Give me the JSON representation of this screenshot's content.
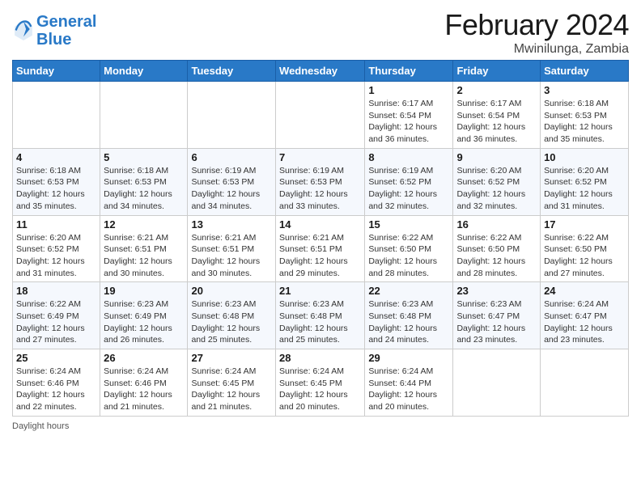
{
  "header": {
    "logo_line1": "General",
    "logo_line2": "Blue",
    "title": "February 2024",
    "subtitle": "Mwinilunga, Zambia"
  },
  "days_of_week": [
    "Sunday",
    "Monday",
    "Tuesday",
    "Wednesday",
    "Thursday",
    "Friday",
    "Saturday"
  ],
  "weeks": [
    [
      {
        "day": "",
        "info": ""
      },
      {
        "day": "",
        "info": ""
      },
      {
        "day": "",
        "info": ""
      },
      {
        "day": "",
        "info": ""
      },
      {
        "day": "1",
        "info": "Sunrise: 6:17 AM\nSunset: 6:54 PM\nDaylight: 12 hours and 36 minutes."
      },
      {
        "day": "2",
        "info": "Sunrise: 6:17 AM\nSunset: 6:54 PM\nDaylight: 12 hours and 36 minutes."
      },
      {
        "day": "3",
        "info": "Sunrise: 6:18 AM\nSunset: 6:53 PM\nDaylight: 12 hours and 35 minutes."
      }
    ],
    [
      {
        "day": "4",
        "info": "Sunrise: 6:18 AM\nSunset: 6:53 PM\nDaylight: 12 hours and 35 minutes."
      },
      {
        "day": "5",
        "info": "Sunrise: 6:18 AM\nSunset: 6:53 PM\nDaylight: 12 hours and 34 minutes."
      },
      {
        "day": "6",
        "info": "Sunrise: 6:19 AM\nSunset: 6:53 PM\nDaylight: 12 hours and 34 minutes."
      },
      {
        "day": "7",
        "info": "Sunrise: 6:19 AM\nSunset: 6:53 PM\nDaylight: 12 hours and 33 minutes."
      },
      {
        "day": "8",
        "info": "Sunrise: 6:19 AM\nSunset: 6:52 PM\nDaylight: 12 hours and 32 minutes."
      },
      {
        "day": "9",
        "info": "Sunrise: 6:20 AM\nSunset: 6:52 PM\nDaylight: 12 hours and 32 minutes."
      },
      {
        "day": "10",
        "info": "Sunrise: 6:20 AM\nSunset: 6:52 PM\nDaylight: 12 hours and 31 minutes."
      }
    ],
    [
      {
        "day": "11",
        "info": "Sunrise: 6:20 AM\nSunset: 6:52 PM\nDaylight: 12 hours and 31 minutes."
      },
      {
        "day": "12",
        "info": "Sunrise: 6:21 AM\nSunset: 6:51 PM\nDaylight: 12 hours and 30 minutes."
      },
      {
        "day": "13",
        "info": "Sunrise: 6:21 AM\nSunset: 6:51 PM\nDaylight: 12 hours and 30 minutes."
      },
      {
        "day": "14",
        "info": "Sunrise: 6:21 AM\nSunset: 6:51 PM\nDaylight: 12 hours and 29 minutes."
      },
      {
        "day": "15",
        "info": "Sunrise: 6:22 AM\nSunset: 6:50 PM\nDaylight: 12 hours and 28 minutes."
      },
      {
        "day": "16",
        "info": "Sunrise: 6:22 AM\nSunset: 6:50 PM\nDaylight: 12 hours and 28 minutes."
      },
      {
        "day": "17",
        "info": "Sunrise: 6:22 AM\nSunset: 6:50 PM\nDaylight: 12 hours and 27 minutes."
      }
    ],
    [
      {
        "day": "18",
        "info": "Sunrise: 6:22 AM\nSunset: 6:49 PM\nDaylight: 12 hours and 27 minutes."
      },
      {
        "day": "19",
        "info": "Sunrise: 6:23 AM\nSunset: 6:49 PM\nDaylight: 12 hours and 26 minutes."
      },
      {
        "day": "20",
        "info": "Sunrise: 6:23 AM\nSunset: 6:48 PM\nDaylight: 12 hours and 25 minutes."
      },
      {
        "day": "21",
        "info": "Sunrise: 6:23 AM\nSunset: 6:48 PM\nDaylight: 12 hours and 25 minutes."
      },
      {
        "day": "22",
        "info": "Sunrise: 6:23 AM\nSunset: 6:48 PM\nDaylight: 12 hours and 24 minutes."
      },
      {
        "day": "23",
        "info": "Sunrise: 6:23 AM\nSunset: 6:47 PM\nDaylight: 12 hours and 23 minutes."
      },
      {
        "day": "24",
        "info": "Sunrise: 6:24 AM\nSunset: 6:47 PM\nDaylight: 12 hours and 23 minutes."
      }
    ],
    [
      {
        "day": "25",
        "info": "Sunrise: 6:24 AM\nSunset: 6:46 PM\nDaylight: 12 hours and 22 minutes."
      },
      {
        "day": "26",
        "info": "Sunrise: 6:24 AM\nSunset: 6:46 PM\nDaylight: 12 hours and 21 minutes."
      },
      {
        "day": "27",
        "info": "Sunrise: 6:24 AM\nSunset: 6:45 PM\nDaylight: 12 hours and 21 minutes."
      },
      {
        "day": "28",
        "info": "Sunrise: 6:24 AM\nSunset: 6:45 PM\nDaylight: 12 hours and 20 minutes."
      },
      {
        "day": "29",
        "info": "Sunrise: 6:24 AM\nSunset: 6:44 PM\nDaylight: 12 hours and 20 minutes."
      },
      {
        "day": "",
        "info": ""
      },
      {
        "day": "",
        "info": ""
      }
    ]
  ],
  "footer": {
    "note": "Daylight hours"
  }
}
